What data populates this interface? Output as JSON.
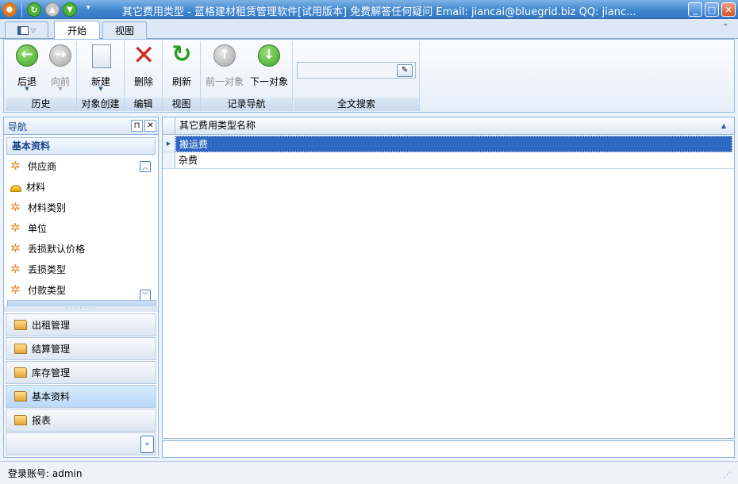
{
  "window": {
    "title": "其它费用类型 - 蓝格建材租赁管理软件[试用版本] 免费解答任何疑问 Email: jiancai@bluegrid.biz QQ: jianc..."
  },
  "ribbon": {
    "tabs": [
      {
        "label": "开始"
      },
      {
        "label": "视图"
      }
    ],
    "groups": {
      "history": {
        "label": "历史",
        "back": "后退",
        "forward": "向前"
      },
      "create": {
        "label": "对象创建",
        "new": "新建"
      },
      "edit": {
        "label": "编辑",
        "delete": "删除"
      },
      "view": {
        "label": "视图",
        "refresh": "刷新"
      },
      "nav": {
        "label": "记录导航",
        "prev": "前一对象",
        "next": "下一对象"
      },
      "search": {
        "label": "全文搜索",
        "value": ""
      }
    }
  },
  "nav": {
    "title": "导航",
    "group_title": "基本资料",
    "items": [
      {
        "label": "供应商",
        "icon": "gear-icon"
      },
      {
        "label": "材料",
        "icon": "helmet-icon"
      },
      {
        "label": "材料类别",
        "icon": "gear-icon"
      },
      {
        "label": "单位",
        "icon": "gear-icon"
      },
      {
        "label": "丢损默认价格",
        "icon": "gear-icon"
      },
      {
        "label": "丢损类型",
        "icon": "gear-icon"
      },
      {
        "label": "付款类型",
        "icon": "gear-icon"
      }
    ],
    "sections": [
      {
        "label": "出租管理"
      },
      {
        "label": "结算管理"
      },
      {
        "label": "库存管理"
      },
      {
        "label": "基本资料"
      },
      {
        "label": "报表"
      }
    ]
  },
  "grid": {
    "column": "其它费用类型名称",
    "rows": [
      {
        "name": "搬运费"
      },
      {
        "name": "杂费"
      }
    ]
  },
  "status": {
    "text": "登录账号: admin"
  },
  "colors": {
    "accent": "#3f86cf",
    "selection": "#2f68c0"
  }
}
